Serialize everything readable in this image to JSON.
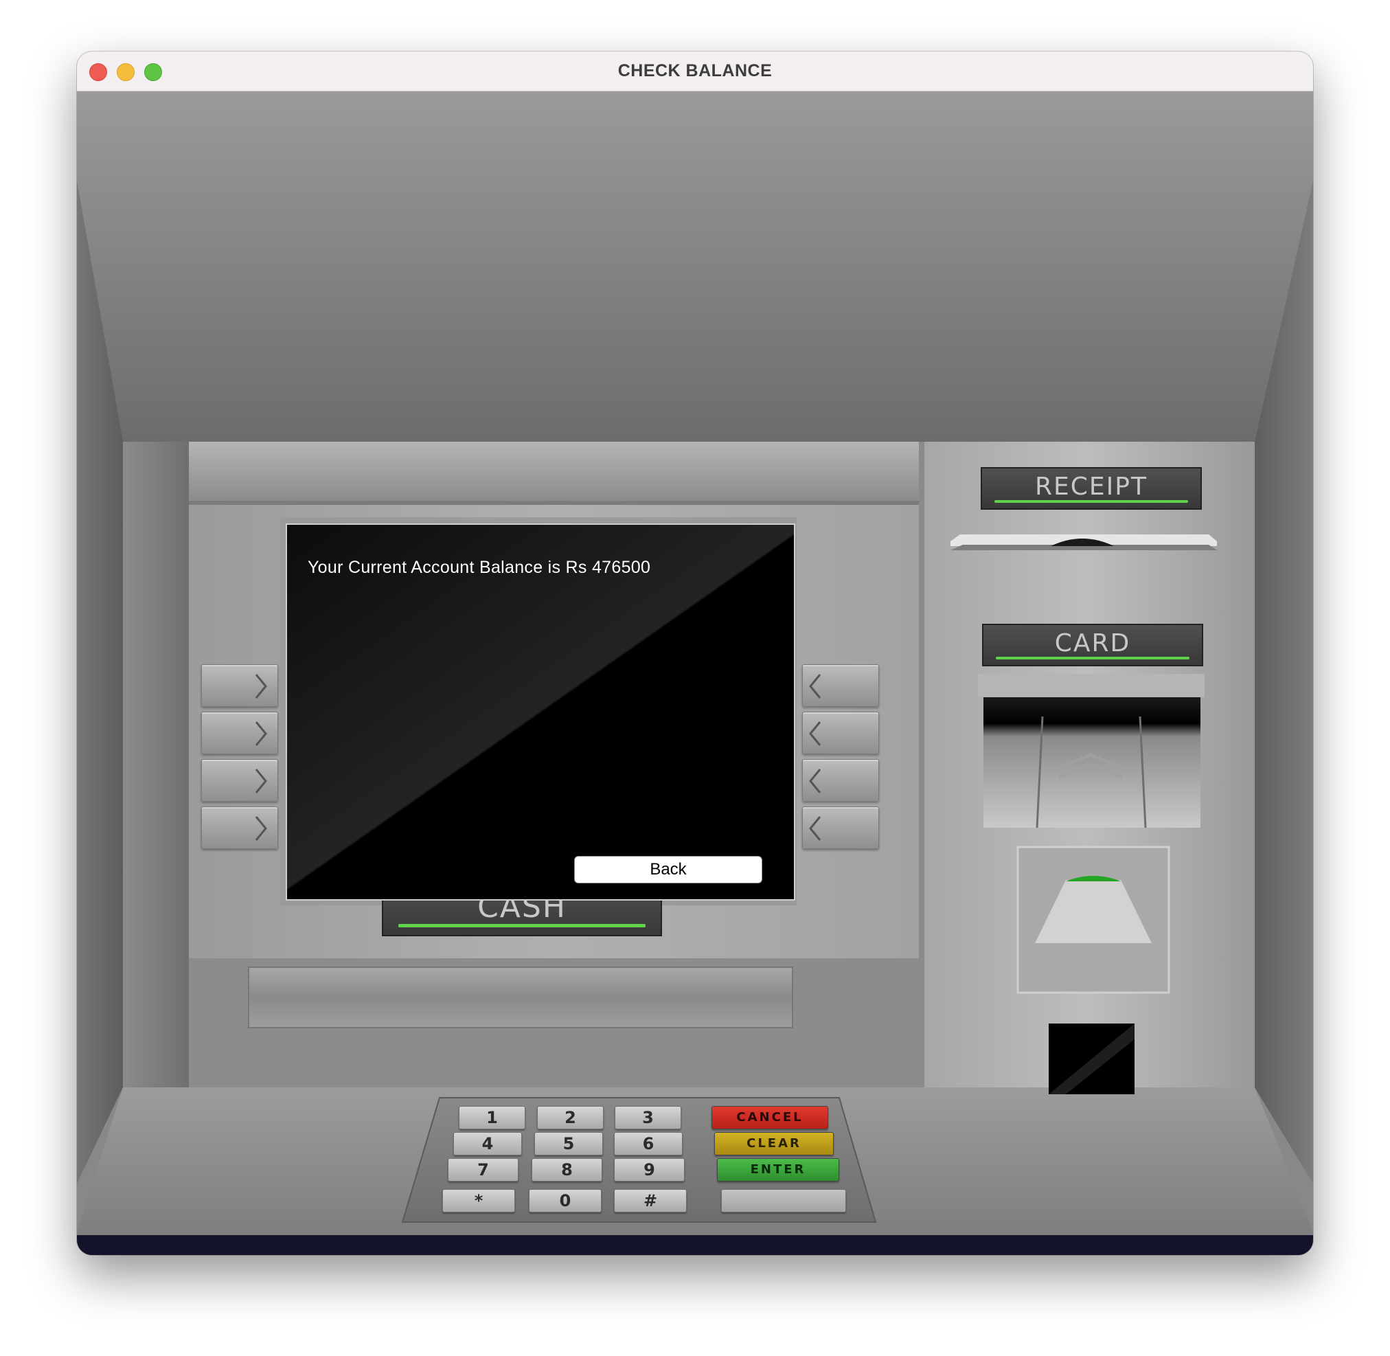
{
  "window": {
    "title": "CHECK BALANCE",
    "traffic_lights": [
      {
        "name": "close",
        "color": "#ee5b52"
      },
      {
        "name": "minimize",
        "color": "#f5bd3c"
      },
      {
        "name": "zoom",
        "color": "#5fc343"
      }
    ]
  },
  "screen": {
    "message": "Your Current Account Balance is Rs 476500",
    "back_label": "Back"
  },
  "labels": {
    "receipt": "RECEIPT",
    "card": "CARD",
    "cash": "CASH"
  },
  "keypad": {
    "digits": [
      "1",
      "2",
      "3",
      "4",
      "5",
      "6",
      "7",
      "8",
      "9",
      "*",
      "0",
      "#"
    ],
    "cancel": "CANCEL",
    "clear": "CLEAR",
    "enter": "ENTER"
  },
  "colors": {
    "indicator_green": "#5fd24a",
    "cancel": "#d42a20",
    "clear": "#c7a418",
    "enter": "#3aa43a"
  }
}
